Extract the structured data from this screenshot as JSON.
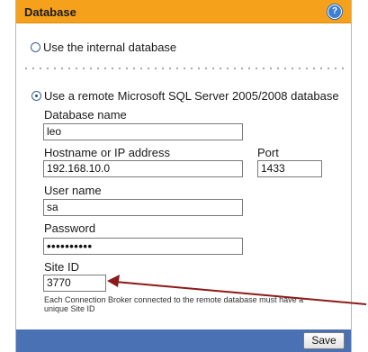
{
  "header": {
    "title": "Database",
    "help_glyph": "?"
  },
  "options": {
    "internal_label": "Use the internal database",
    "remote_label": "Use a remote Microsoft SQL Server 2005/2008 database",
    "selected": "remote"
  },
  "form": {
    "database_name_label": "Database name",
    "database_name_value": "leo",
    "hostname_label": "Hostname or IP address",
    "hostname_value": "192.168.10.0",
    "port_label": "Port",
    "port_value": "1433",
    "username_label": "User name",
    "username_value": "sa",
    "password_label": "Password",
    "password_mask": "••••••••••",
    "site_id_label": "Site ID",
    "site_id_value": "3770",
    "site_id_note": "Each Connection Broker connected to the remote database must have a unique Site ID"
  },
  "footer": {
    "save_label": "Save"
  },
  "colors": {
    "header_bg": "#f6a11c",
    "footer_bg": "#4a71b3",
    "arrow": "#8b1a1a"
  },
  "icons": [
    "help-icon",
    "radio-unchecked-icon",
    "radio-checked-icon",
    "annotation-arrow-icon"
  ]
}
